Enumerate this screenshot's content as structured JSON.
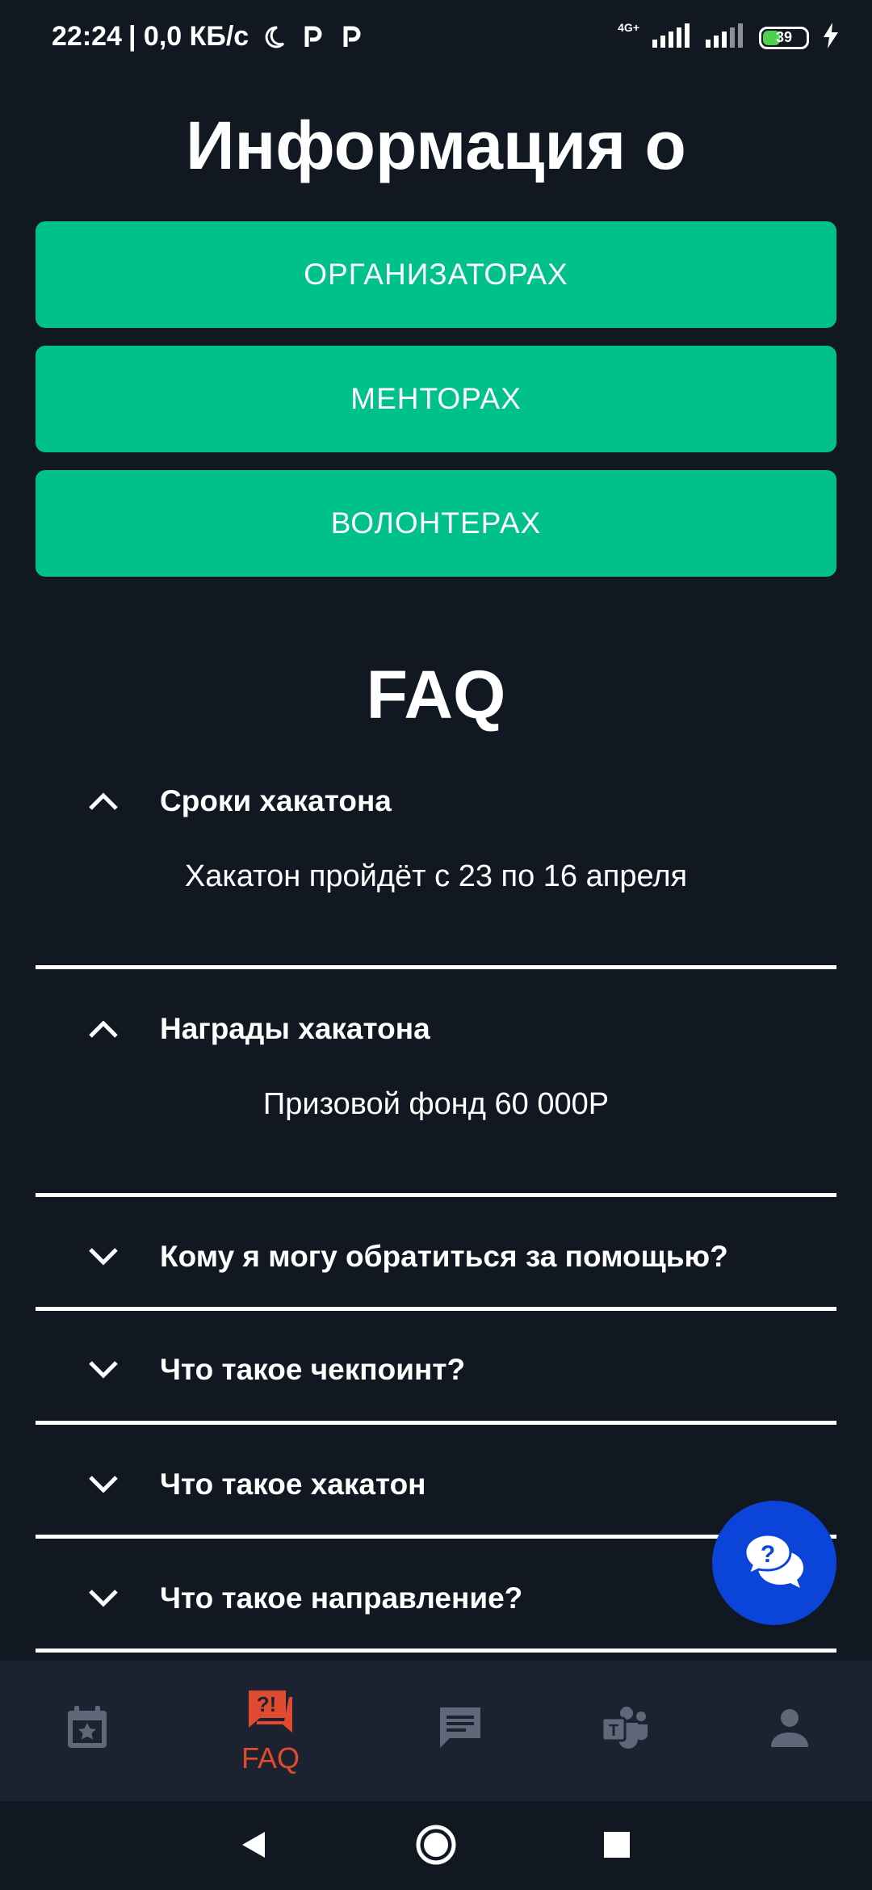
{
  "status_bar": {
    "time": "22:24",
    "network_speed": "| 0,0 КБ/с",
    "network_type": "4G+",
    "battery": "39"
  },
  "info": {
    "title": "Информация о",
    "buttons": [
      {
        "label": "ОРГАНИЗАТОРАХ"
      },
      {
        "label": "МЕНТОРАХ"
      },
      {
        "label": "ВОЛОНТЕРАХ"
      }
    ]
  },
  "faq": {
    "title": "FAQ",
    "items": [
      {
        "question": "Сроки хакатона",
        "expanded": true,
        "answer": "Хакатон пройдёт с 23 по 16 апреля"
      },
      {
        "question": "Награды хакатона",
        "expanded": true,
        "answer": "Призовой фонд 60 000Р"
      },
      {
        "question": "Кому я могу обратиться за помощью?",
        "expanded": false
      },
      {
        "question": "Что такое чекпоинт?",
        "expanded": false
      },
      {
        "question": "Что такое хакатон",
        "expanded": false
      },
      {
        "question": "Что такое направление?",
        "expanded": false
      }
    ]
  },
  "fab": {
    "icon": "help-chat-icon"
  },
  "bottom_nav": {
    "items": [
      {
        "icon": "calendar-star-icon",
        "label": "",
        "active": false
      },
      {
        "icon": "faq-icon",
        "label": "FAQ",
        "active": true
      },
      {
        "icon": "chat-icon",
        "label": "",
        "active": false
      },
      {
        "icon": "teams-icon",
        "label": "",
        "active": false
      },
      {
        "icon": "profile-icon",
        "label": "",
        "active": false
      }
    ]
  },
  "colors": {
    "background": "#121822",
    "accent_green": "#00c08b",
    "fab_blue": "#0a44d8",
    "nav_active": "#e04a2f",
    "nav_inactive": "#5f6878"
  }
}
